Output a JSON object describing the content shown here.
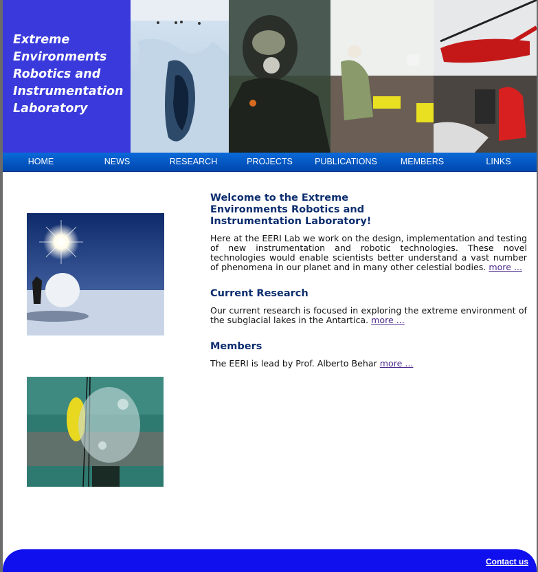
{
  "header": {
    "title_lines": [
      "Extreme",
      "Environments",
      "Robotics and",
      "Instrumentation",
      "Laboratory"
    ],
    "brand_color": "#3a3adc"
  },
  "nav": {
    "items": [
      {
        "label": "HOME"
      },
      {
        "label": "NEWS"
      },
      {
        "label": "RESEARCH"
      },
      {
        "label": "PROJECTS"
      },
      {
        "label": "PUBLICATIONS"
      },
      {
        "label": "MEMBERS"
      },
      {
        "label": "LINKS"
      }
    ]
  },
  "main": {
    "welcome_title": "Welcome to the Extreme Environments Robotics and Instrumentation Laboratory!",
    "welcome_text": "Here at the EERI Lab we work on the design, implementation and testing of new instrumentation and robotic technologies. These novel technologies would enable scientists better understand a vast number of phenomena in our planet and in many other celestial bodies.",
    "current_research_title": "Current Research",
    "current_research_text": "Our current research is focused in exploring the extreme environment of the subglacial lakes in the Antartica.",
    "members_title": "Members",
    "members_text": "The EERI is lead by Prof. Alberto Behar",
    "more_label": "more ..."
  },
  "footer": {
    "contact_label": "Contact us"
  }
}
